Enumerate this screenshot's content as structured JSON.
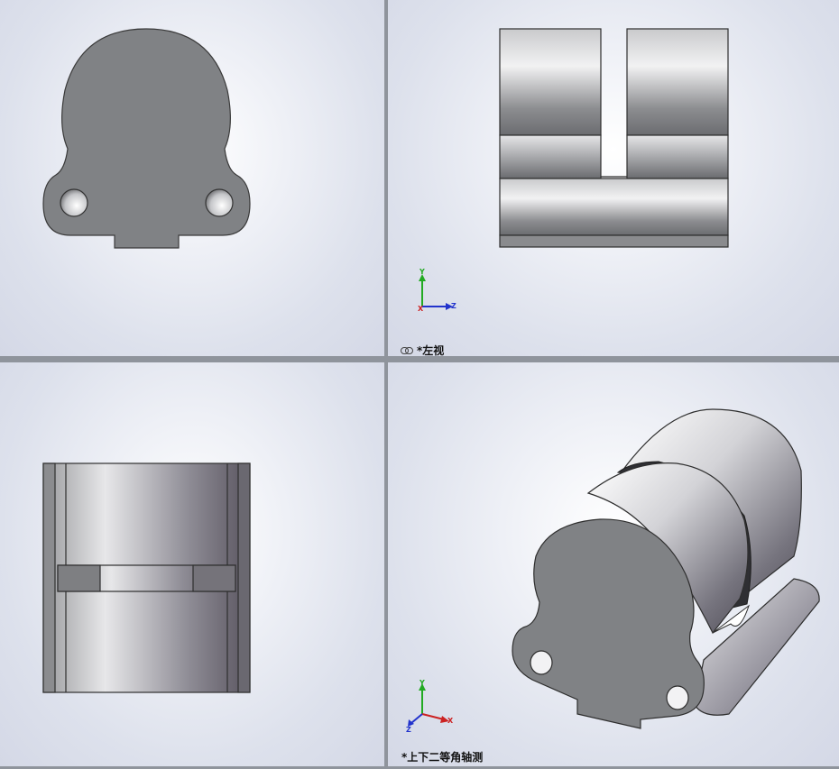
{
  "viewports": {
    "top_left": {
      "label": ""
    },
    "top_right": {
      "label": "*左视",
      "linked": true
    },
    "bottom_left": {
      "label": ""
    },
    "bottom_right": {
      "label": "*上下二等角轴测"
    }
  },
  "triad": {
    "x": "Z",
    "y": "Y",
    "z": "Z",
    "x_axis": "X"
  },
  "colors": {
    "background_center": "#ffffff",
    "background_edge": "#d4d8e6",
    "part_face": "#808285",
    "triad_x": "#cc2222",
    "triad_y": "#22aa22",
    "triad_z": "#2233cc"
  }
}
